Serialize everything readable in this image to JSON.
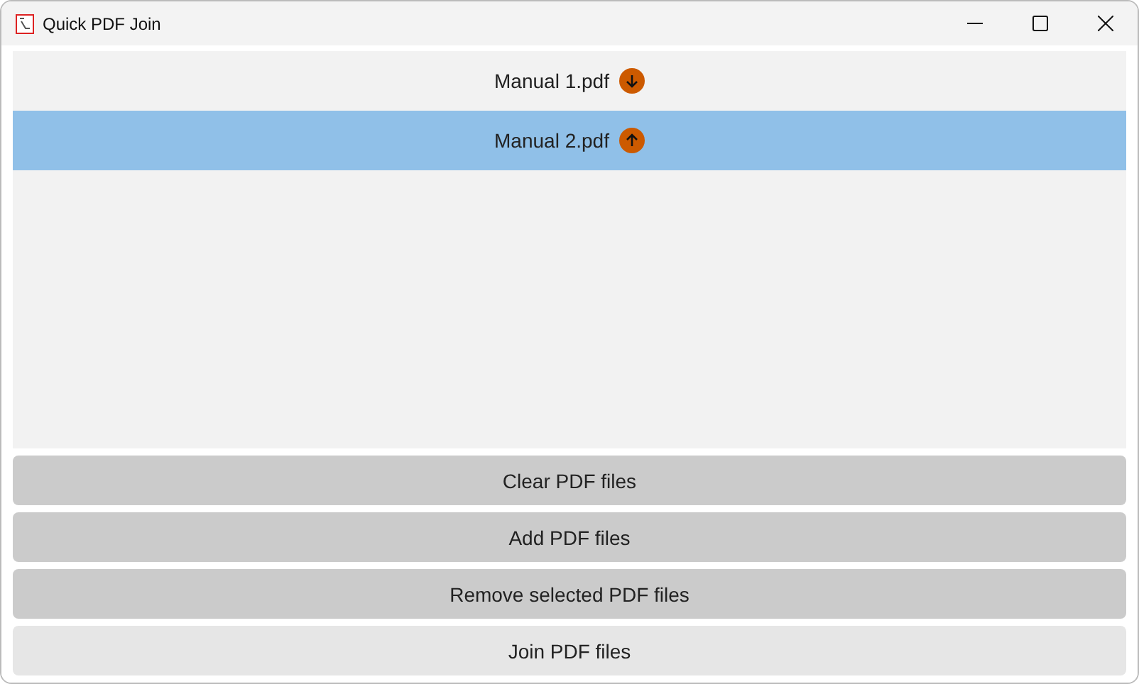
{
  "window": {
    "title": "Quick PDF Join"
  },
  "files": [
    {
      "name": "Manual 1.pdf",
      "kind": "down",
      "selected": false
    },
    {
      "name": "Manual 2.pdf",
      "kind": "up",
      "selected": true
    }
  ],
  "buttons": [
    {
      "label": "Clear PDF files",
      "disabled": false
    },
    {
      "label": "Add PDF files",
      "disabled": false
    },
    {
      "label": "Remove selected PDF files",
      "disabled": false
    },
    {
      "label": "Join PDF files",
      "disabled": true
    }
  ]
}
